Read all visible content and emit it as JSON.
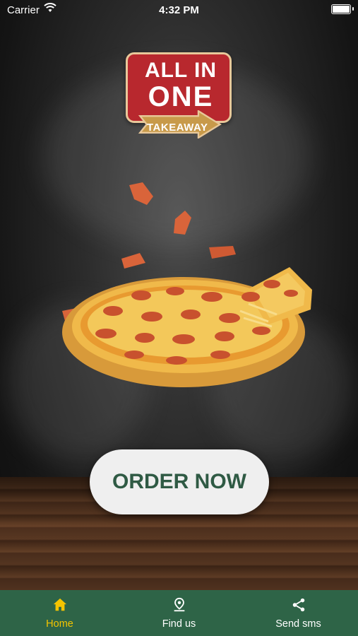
{
  "status_bar": {
    "carrier": "Carrier",
    "time": "4:32 PM"
  },
  "logo": {
    "line1": "ALL IN",
    "line2": "ONE",
    "tagline": "TAKEAWAY"
  },
  "order_button": {
    "label": "ORDER NOW"
  },
  "tabbar": {
    "items": [
      {
        "label": "Home",
        "icon": "home-icon",
        "active": true
      },
      {
        "label": "Find us",
        "icon": "location-pin-icon",
        "active": false
      },
      {
        "label": "Send sms",
        "icon": "share-icon",
        "active": false
      }
    ]
  },
  "colors": {
    "tabbar_bg": "#2e6447",
    "active_tab": "#f5c400",
    "button_text": "#2f5a44",
    "logo_red": "#b8282e"
  }
}
